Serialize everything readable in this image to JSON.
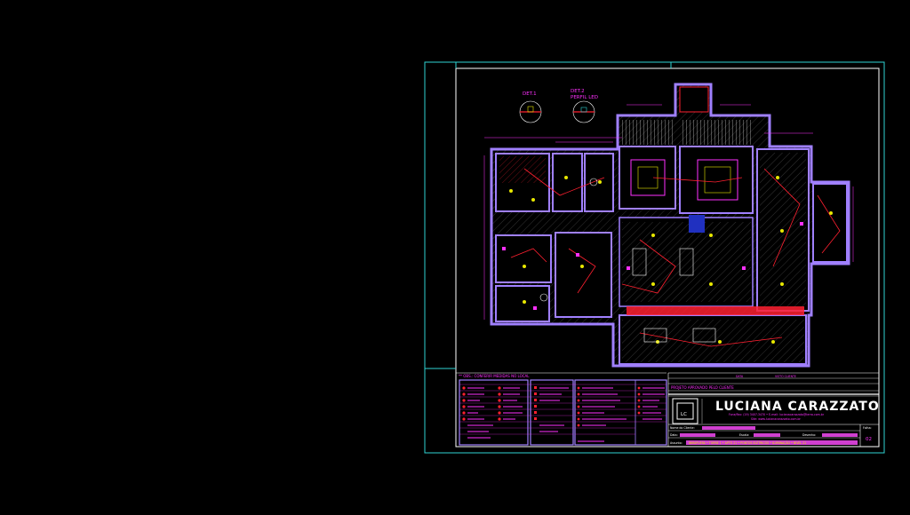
{
  "details": {
    "det1": "DET.1",
    "det2_line1": "DET.2",
    "det2_line2": "PERFIL LED"
  },
  "notes": {
    "obs": "** OBS.: CONFERIR MEDIDAS NO LOCAL"
  },
  "titleblock": {
    "header_left": "DATA",
    "header_right": "VISTO CLIENTE",
    "approval": "PROJETO APROVADO PELO CLIENTE",
    "brand": "LUCIANA CARAZZATO",
    "contact": "Fone/Fax: (19) 3407-3470 • E-mail: lucianacarazzato@terra.com.br",
    "site": "Site: www.lucianacarazzato.com.br",
    "client_label": "Nome do Cliente:",
    "date_label": "Data:",
    "scale_label": "Escala:",
    "drawn_label": "Desenho:",
    "subject_label": "Assunto:",
    "subject_value": "IBIRAPUERA • TORRE 1 • APTO 21 • PONTOS ELÉTRICOS • ILUMINAÇÃO • NÍVEL 21",
    "sheet_label": "Folha:",
    "sheet_number": "02"
  },
  "colors": {
    "frame": "#2fd5d5",
    "walls": "#a080ff",
    "magenta": "#ff30ff",
    "red": "#ff2030",
    "yellow": "#e8e800",
    "white": "#ffffff"
  }
}
